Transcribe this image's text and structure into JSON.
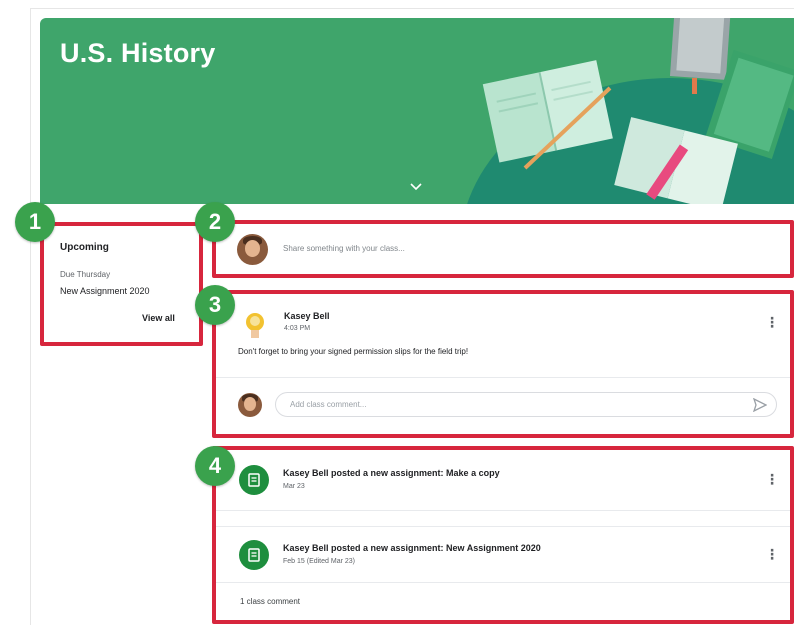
{
  "course": {
    "title": "U.S. History"
  },
  "badges": [
    "1",
    "2",
    "3",
    "4"
  ],
  "upcoming": {
    "title": "Upcoming",
    "due": "Due Thursday",
    "item": "New Assignment 2020",
    "view_all": "View all"
  },
  "share": {
    "placeholder": "Share something with your class..."
  },
  "post": {
    "author": "Kasey Bell",
    "time": "4:03 PM",
    "body": "Don't forget to bring your signed permission slips for the field trip!",
    "comment_placeholder": "Add class comment..."
  },
  "assignments": [
    {
      "title": "Kasey Bell posted a new assignment: Make a copy",
      "date": "Mar 23"
    },
    {
      "title": "Kasey Bell posted a new assignment: New Assignment 2020",
      "date": "Feb 15 (Edited Mar 23)",
      "comments": "1 class comment"
    }
  ],
  "colors": {
    "banner": "#3fa56b",
    "banner_dark": "#1f8a70",
    "badge": "#3aa24d",
    "highlight": "#d7263d",
    "assignment_icon": "#1e8e3e"
  },
  "icons": [
    "chevron-down-icon",
    "more-vert-icon",
    "send-icon",
    "assignment-icon"
  ]
}
